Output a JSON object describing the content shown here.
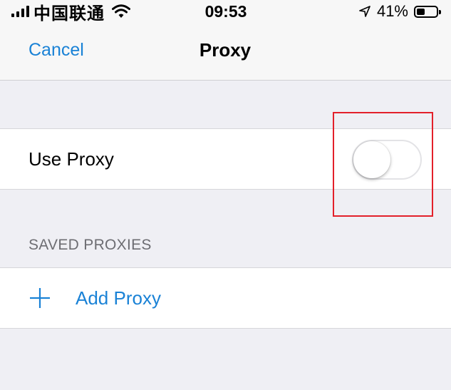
{
  "status_bar": {
    "carrier": "中国联通",
    "time": "09:53",
    "battery_percent": "41%",
    "battery_level": 0.41,
    "icons": [
      "signal-icon",
      "wifi-icon",
      "location-icon",
      "battery-icon"
    ]
  },
  "nav": {
    "cancel_label": "Cancel",
    "title": "Proxy"
  },
  "use_proxy": {
    "label": "Use Proxy",
    "enabled": false
  },
  "saved_proxies": {
    "header": "SAVED PROXIES",
    "add_label": "Add Proxy"
  },
  "colors": {
    "accent": "#1a82d6",
    "highlight": "#e3202a",
    "background": "#efeff4"
  }
}
